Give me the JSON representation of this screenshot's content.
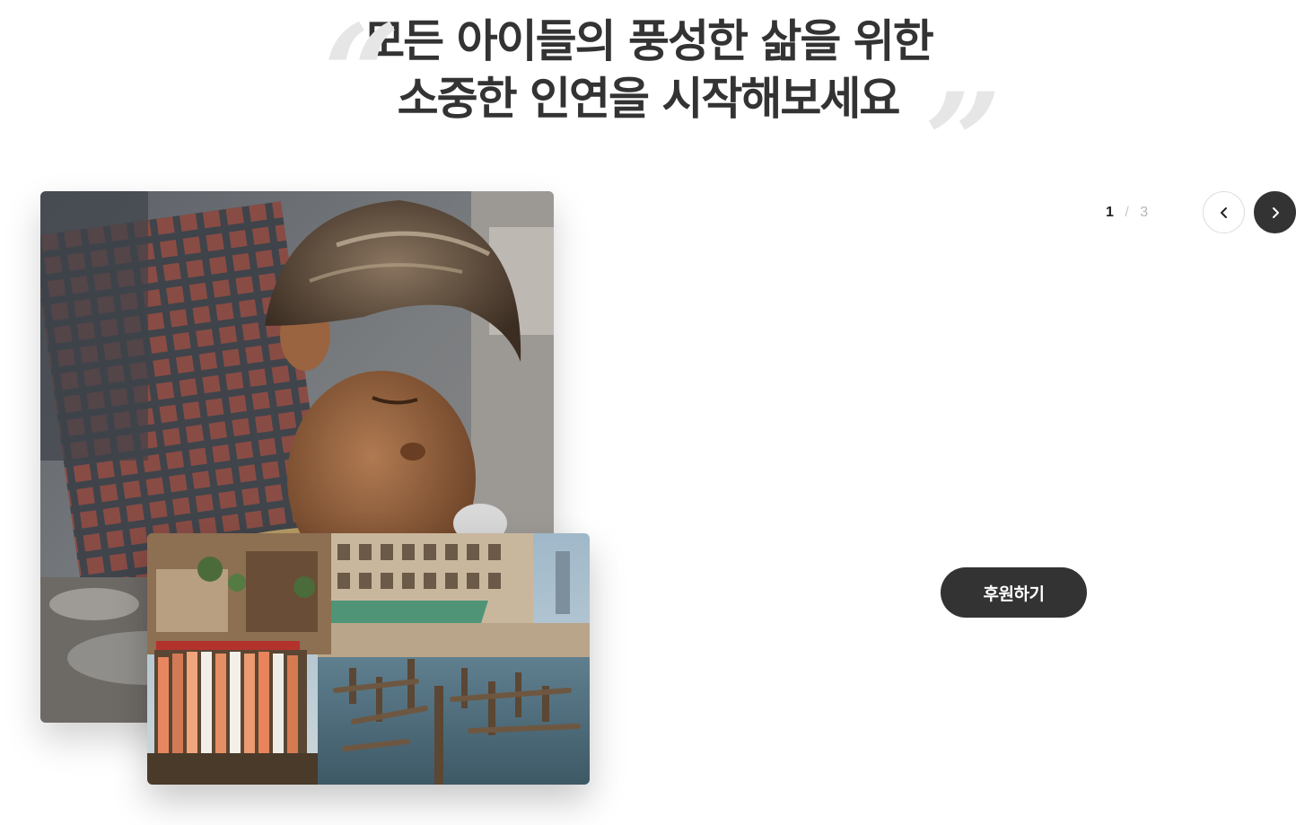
{
  "headline": {
    "line1": "모든 아이들의 풍성한 삶을 위한",
    "line2": "소중한 인연을 시작해보세요",
    "quote_open": "“",
    "quote_close": "”"
  },
  "slider": {
    "current": "1",
    "separator": "/",
    "total": "3",
    "prev_icon": "chevron-left-icon",
    "next_icon": "chevron-right-icon"
  },
  "cta": {
    "label": "후원하기"
  },
  "images": {
    "main": "child-photo",
    "sub": "waterfront-slum-photo"
  },
  "colors": {
    "text": "#333333",
    "button_dark": "#333333",
    "quote_mark": "#e6e6e6",
    "muted": "#b5b5b5"
  }
}
